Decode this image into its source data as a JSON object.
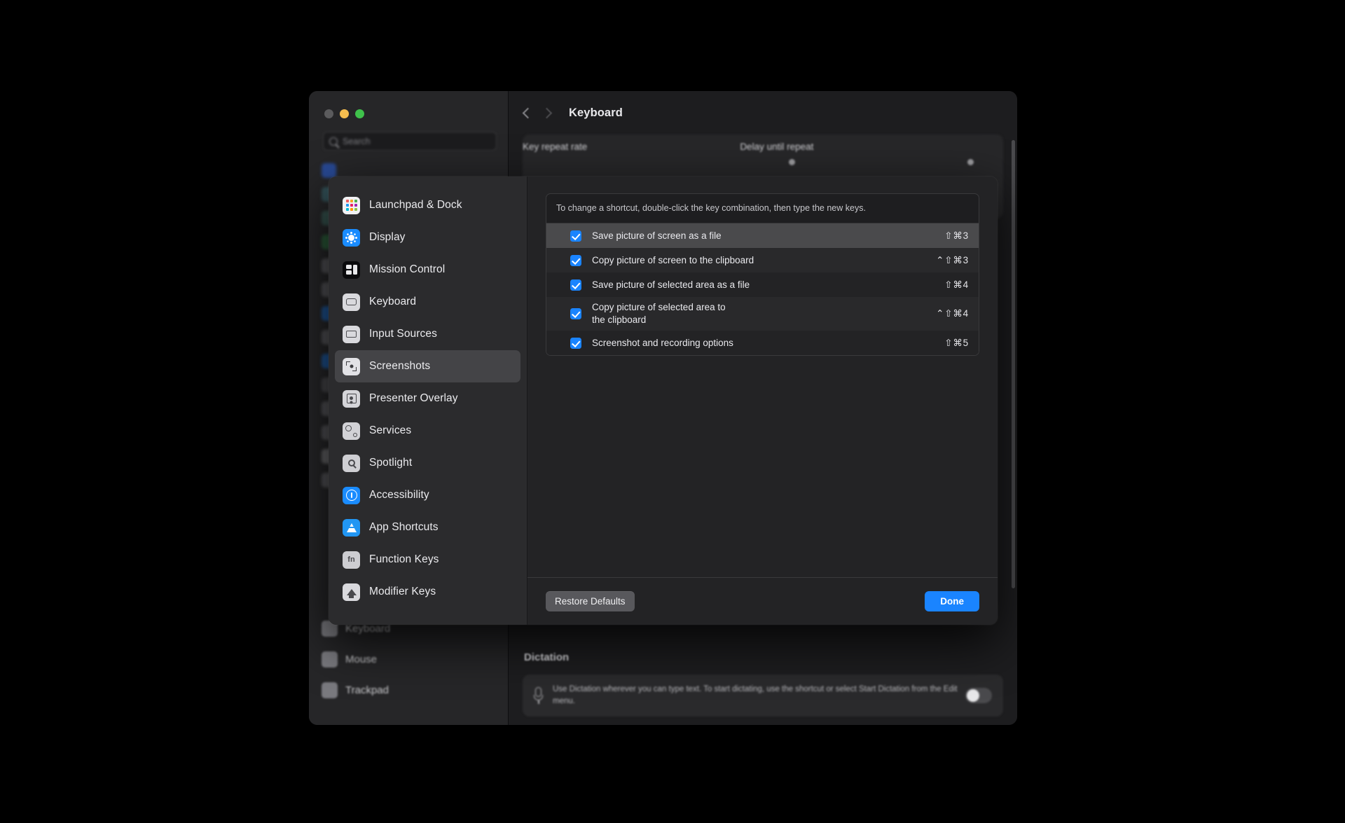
{
  "window": {
    "title": "Keyboard",
    "traffic_lights": [
      "close-disabled",
      "minimize",
      "zoom"
    ],
    "search_placeholder": "Search",
    "key_repeat_rate_label": "Key repeat rate",
    "delay_until_repeat_label": "Delay until repeat",
    "dictation_heading": "Dictation",
    "dictation_description": "Use Dictation wherever you can type text. To start dictating, use the shortcut or select Start Dictation from the Edit menu."
  },
  "background_sidebar": {
    "faint_items": [
      {
        "color": "#2a5fd6"
      },
      {
        "color": "#3a6a74"
      },
      {
        "color": "#3d6b63"
      },
      {
        "color": "#2f7a44"
      },
      {
        "color": "#6d6d72"
      },
      {
        "color": "#6d6d72"
      },
      {
        "color": "#1a6fd4"
      },
      {
        "color": "#6d6d72"
      },
      {
        "color": "#1a6fd4"
      },
      {
        "color": "#5c5c61"
      },
      {
        "color": "#6d6d72"
      },
      {
        "color": "#6d6d72"
      },
      {
        "color": "#8a8a8e"
      },
      {
        "color": "#6d6d72"
      }
    ],
    "visible_items": [
      {
        "label": "Keyboard",
        "color": "#7a7a7f"
      },
      {
        "label": "Mouse",
        "color": "#7a7a7f"
      },
      {
        "label": "Trackpad",
        "color": "#7a7a7f"
      }
    ]
  },
  "sheet": {
    "sidebar_items": [
      {
        "label": "Launchpad & Dock",
        "icon": "launchpad-dock-icon",
        "icon_class": "ic-launchpad",
        "selected": false
      },
      {
        "label": "Display",
        "icon": "display-icon",
        "icon_class": "ic-display",
        "selected": false
      },
      {
        "label": "Mission Control",
        "icon": "mission-control-icon",
        "icon_class": "ic-mission",
        "selected": false
      },
      {
        "label": "Keyboard",
        "icon": "keyboard-icon",
        "icon_class": "ic-keyboard",
        "selected": false
      },
      {
        "label": "Input Sources",
        "icon": "input-sources-icon",
        "icon_class": "ic-input",
        "selected": false
      },
      {
        "label": "Screenshots",
        "icon": "screenshots-icon",
        "icon_class": "ic-screenshots",
        "selected": true
      },
      {
        "label": "Presenter Overlay",
        "icon": "presenter-overlay-icon",
        "icon_class": "ic-presenter",
        "selected": false
      },
      {
        "label": "Services",
        "icon": "services-icon",
        "icon_class": "ic-services",
        "selected": false
      },
      {
        "label": "Spotlight",
        "icon": "spotlight-icon",
        "icon_class": "ic-spotlight",
        "selected": false
      },
      {
        "label": "Accessibility",
        "icon": "accessibility-icon",
        "icon_class": "ic-accessibility",
        "selected": false
      },
      {
        "label": "App Shortcuts",
        "icon": "app-shortcuts-icon",
        "icon_class": "ic-appshortcuts",
        "selected": false
      },
      {
        "label": "Function Keys",
        "icon": "function-keys-icon",
        "icon_class": "ic-function",
        "selected": false
      },
      {
        "label": "Modifier Keys",
        "icon": "modifier-keys-icon",
        "icon_class": "ic-modifier",
        "selected": false
      }
    ],
    "hint": "To change a shortcut, double-click the key combination, then type the new keys.",
    "shortcuts": [
      {
        "label": "Save picture of screen as a file",
        "keys": "⇧⌘3",
        "checked": true,
        "selected": true,
        "multiline": false
      },
      {
        "label": "Copy picture of screen to the clipboard",
        "keys": "⌃⇧⌘3",
        "checked": true,
        "selected": false,
        "multiline": false
      },
      {
        "label": "Save picture of selected area as a file",
        "keys": "⇧⌘4",
        "checked": true,
        "selected": false,
        "multiline": false
      },
      {
        "label": "Copy picture of selected area to\nthe clipboard",
        "keys": "⌃⇧⌘4",
        "checked": true,
        "selected": false,
        "multiline": true
      },
      {
        "label": "Screenshot and recording options",
        "keys": "⇧⌘5",
        "checked": true,
        "selected": false,
        "multiline": false
      }
    ],
    "restore_defaults_label": "Restore Defaults",
    "done_label": "Done"
  },
  "colors": {
    "accent_blue": "#1a84ff",
    "selection_gray": "#4a4a4c",
    "sheet_bg": "#232325",
    "window_bg": "#1d1d1f"
  }
}
